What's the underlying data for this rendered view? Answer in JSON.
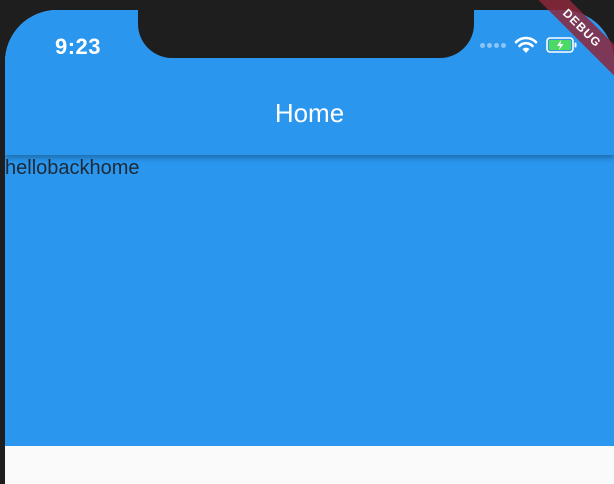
{
  "status_bar": {
    "time": "9:23",
    "wifi_icon": "wifi-icon",
    "battery_icon": "battery-charging-icon",
    "battery_color": "#4cd964"
  },
  "app_bar": {
    "title": "Home",
    "color": "#2a96ee"
  },
  "body": {
    "text": "hellobackhome"
  },
  "debug_banner": {
    "label": "DEBUG",
    "color": "#8c283c"
  }
}
